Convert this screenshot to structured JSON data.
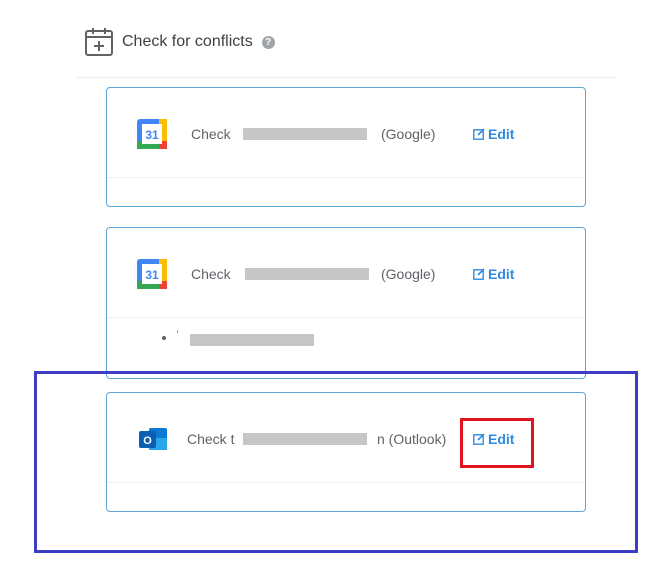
{
  "header": {
    "title": "Check for conflicts",
    "help": "?"
  },
  "calendars": [
    {
      "prefix": "Check",
      "suffix": "(Google)",
      "edit_label": "Edit",
      "provider": "google"
    },
    {
      "prefix": "Check",
      "suffix": "(Google)",
      "edit_label": "Edit",
      "provider": "google"
    },
    {
      "prefix": "Check t",
      "suffix": "n (Outlook)",
      "edit_label": "Edit",
      "provider": "outlook"
    }
  ],
  "icons": {
    "google_calendar_day": "31",
    "outlook_letter": "O"
  },
  "colors": {
    "accent": "#2f8ae0",
    "card_border": "#5da6d9",
    "highlight_blue": "#3d3dc4",
    "highlight_red": "#e0141e",
    "redaction": "#c6c6c6"
  }
}
